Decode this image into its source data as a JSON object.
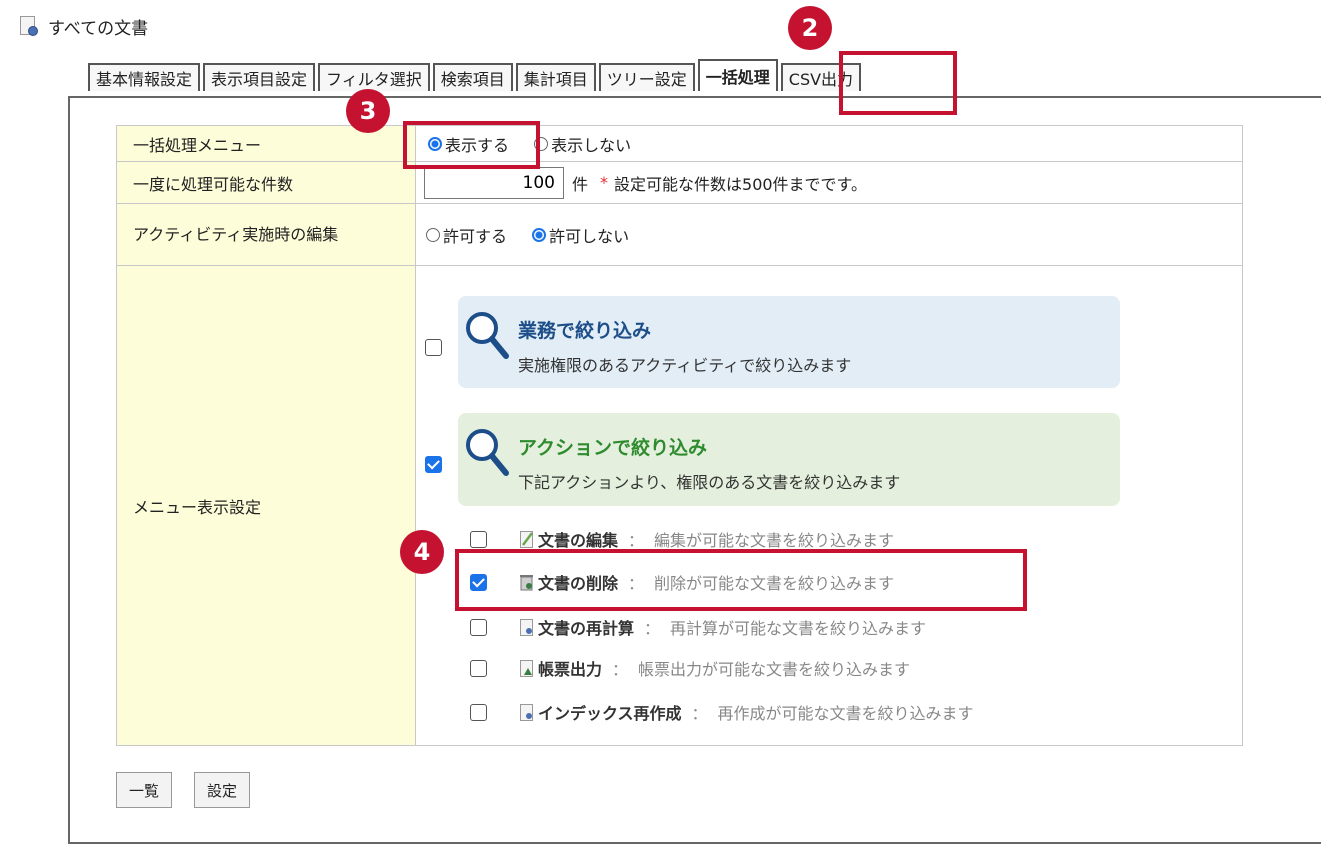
{
  "page": {
    "title": "すべての文書"
  },
  "tabs": [
    {
      "label": "基本情報設定"
    },
    {
      "label": "表示項目設定"
    },
    {
      "label": "フィルタ選択"
    },
    {
      "label": "検索項目"
    },
    {
      "label": "集計項目"
    },
    {
      "label": "ツリー設定"
    },
    {
      "label": "一括処理",
      "active": true
    },
    {
      "label": "CSV出力"
    }
  ],
  "rows": {
    "batch_menu": {
      "label": "一括処理メニュー",
      "options": [
        "表示する",
        "表示しない"
      ],
      "selected": "表示する"
    },
    "max_count": {
      "label": "一度に処理可能な件数",
      "value": "100",
      "unit": "件",
      "required_mark": "*",
      "note": "設定可能な件数は500件までです。"
    },
    "activity_edit": {
      "label": "アクティビティ実施時の編集",
      "options": [
        "許可する",
        "許可しない"
      ],
      "selected": "許可しない"
    },
    "menu_display": {
      "label": "メニュー表示設定"
    }
  },
  "menu_cards": [
    {
      "title": "業務で絞り込み",
      "desc": "実施権限のあるアクティビティで絞り込みます",
      "checked": false,
      "bg": "#e2edf6",
      "title_color": "#1d4e89"
    },
    {
      "title": "アクションで絞り込み",
      "desc": "下記アクションより、権限のある文書を絞り込みます",
      "checked": true,
      "bg": "#e4f0dd",
      "title_color": "#2e8b2e"
    }
  ],
  "actions": [
    {
      "name": "文書の編集",
      "desc": "編集が可能な文書を絞り込みます",
      "checked": false,
      "icon": "edit-doc-icon"
    },
    {
      "name": "文書の削除",
      "desc": "削除が可能な文書を絞り込みます",
      "checked": true,
      "icon": "delete-doc-icon"
    },
    {
      "name": "文書の再計算",
      "desc": "再計算が可能な文書を絞り込みます",
      "checked": false,
      "icon": "recalc-doc-icon"
    },
    {
      "name": "帳票出力",
      "desc": "帳票出力が可能な文書を絞り込みます",
      "checked": false,
      "icon": "report-output-icon"
    },
    {
      "name": "インデックス再作成",
      "desc": "再作成が可能な文書を絞り込みます",
      "checked": false,
      "icon": "reindex-doc-icon"
    }
  ],
  "separator": "：",
  "buttons": {
    "list": "一覧",
    "settings": "設定"
  },
  "markers": [
    "2",
    "3",
    "4"
  ],
  "colors": {
    "annotation": "#c41230",
    "accent": "#1a73e8",
    "label_bg": "#fefdd9"
  }
}
